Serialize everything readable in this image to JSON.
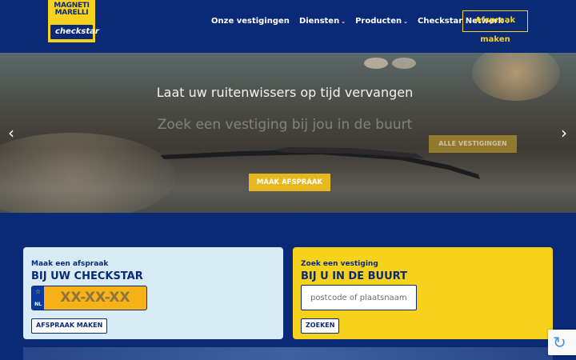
{
  "logo": {
    "line1": "MAGNETI",
    "line2": "MARELLI",
    "subbrand": "checkstar"
  },
  "nav": {
    "items": [
      {
        "label": "Onze vestigingen",
        "dropdown": false
      },
      {
        "label": "Diensten",
        "dropdown": true
      },
      {
        "label": "Producten",
        "dropdown": true
      },
      {
        "label": "Checkstar Netwerk",
        "dropdown": true
      }
    ],
    "chevron": "⌄",
    "cta_label": "Afspraak maken"
  },
  "hero": {
    "headline": "Laat uw ruitenwissers op tijd vervangen",
    "subline": "Zoek een vestiging bij jou in de buurt",
    "all_locations_label": "ALLE VESTIGINGEN",
    "make_appointment_label": "MAAK AFSPRAAK",
    "prev_icon": "‹",
    "next_icon": "›"
  },
  "appointment_card": {
    "small_title": "Maak een afspraak",
    "big_title": "BIJ UW CHECKSTAR",
    "plate_country": "NL",
    "plate_stars": "☆",
    "plate_placeholder": "XX-XX-XX",
    "button_label": "AFSPRAAK MAKEN"
  },
  "search_card": {
    "small_title": "Zoek een vestiging",
    "big_title": "BIJ U IN DE BUURT",
    "input_placeholder": "postcode of plaatsnaam",
    "button_label": "ZOEKEN"
  },
  "recaptcha": {
    "icon": "↻"
  },
  "colors": {
    "navy": "#0a2a78",
    "yellow": "#f6d21c",
    "light_blue": "#d8ecf6",
    "plate_orange": "#f6b216"
  }
}
